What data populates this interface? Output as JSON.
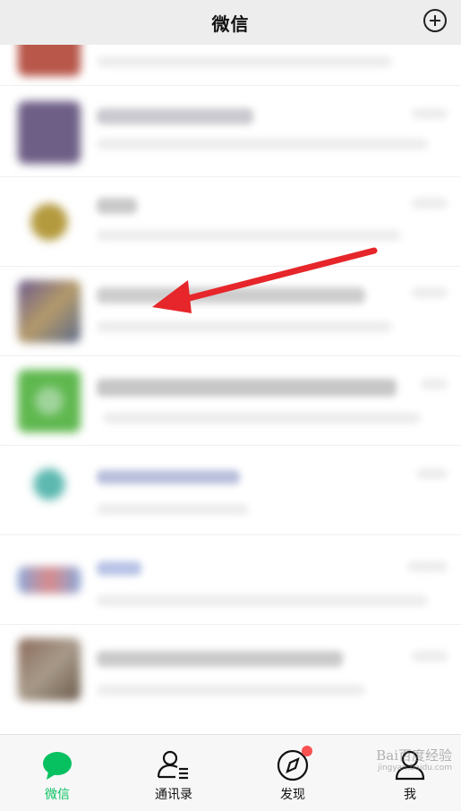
{
  "header": {
    "title": "微信"
  },
  "tabbar": {
    "items": [
      {
        "label": "微信",
        "icon": "chat-bubble-icon"
      },
      {
        "label": "通讯录",
        "icon": "contacts-icon"
      },
      {
        "label": "发现",
        "icon": "compass-icon"
      },
      {
        "label": "我",
        "icon": "person-icon"
      }
    ]
  },
  "watermark": {
    "text": "Bai百度经验",
    "url": "jingyan.baidu.com"
  },
  "colors": {
    "accent": "#07c160",
    "badge": "#fa5151",
    "arrow": "#e6262a"
  }
}
